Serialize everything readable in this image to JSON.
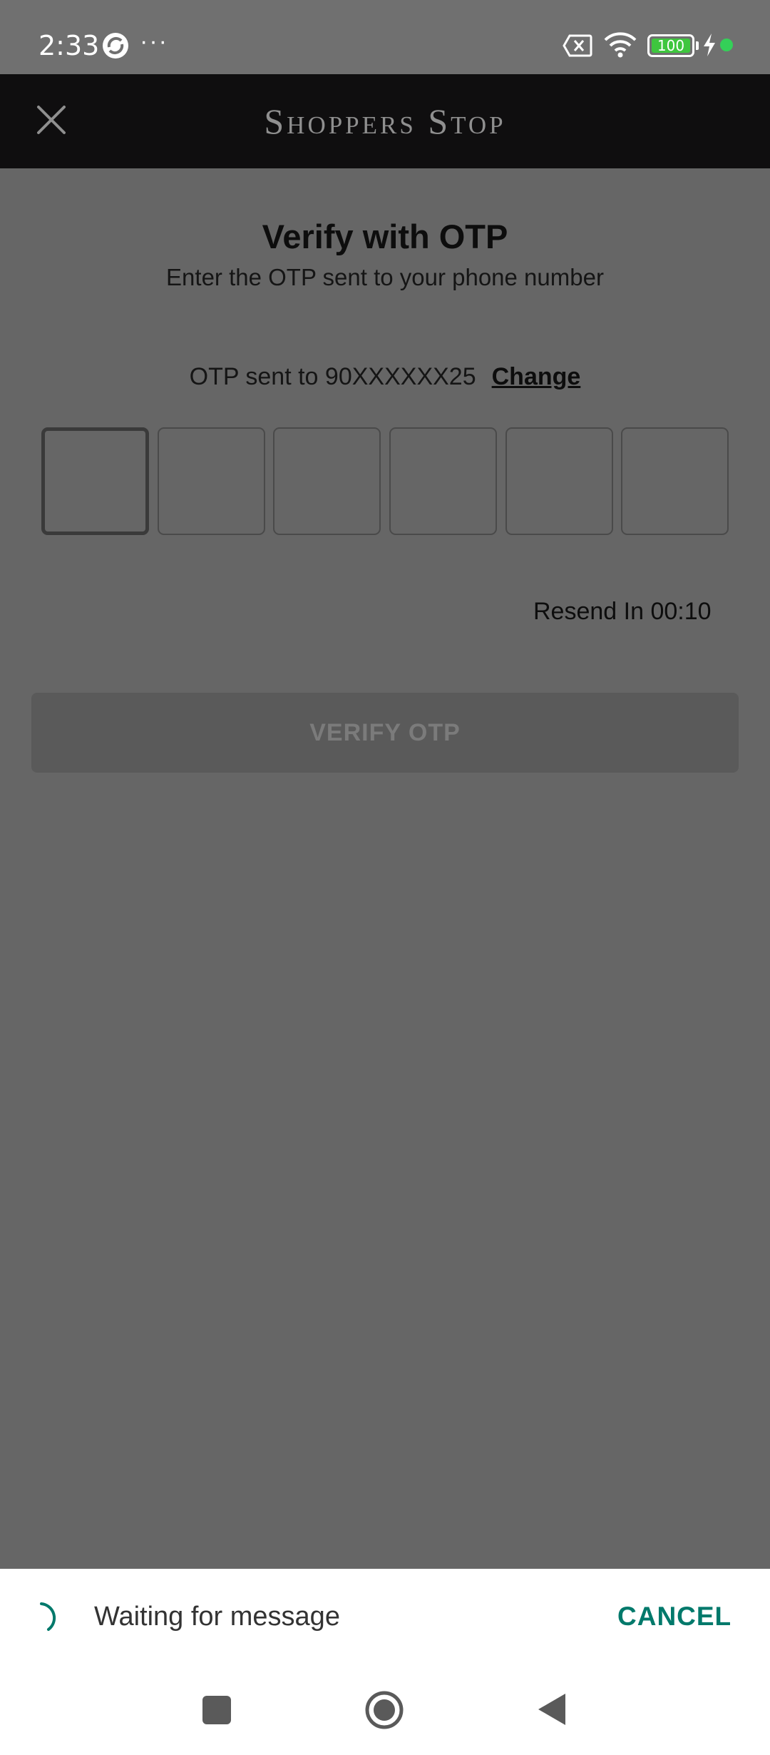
{
  "status_bar": {
    "time": "2:33",
    "more": "···",
    "battery": "100",
    "battery_level": 1.0,
    "icons": [
      "app-sync-icon",
      "sim-none-icon",
      "wifi-icon",
      "battery-icon",
      "charging-icon"
    ],
    "colors": {
      "battery_fill": "#3ec63e",
      "charge_dot": "#34d058"
    }
  },
  "header": {
    "brand": "Shoppers Stop",
    "close_icon": "close-icon"
  },
  "verify": {
    "title": "Verify with OTP",
    "subtitle": "Enter the OTP sent to your phone number",
    "sent_to_label": "OTP sent to 90XXXXXX25",
    "change_label": "Change",
    "otp_digits": [
      "",
      "",
      "",
      "",
      "",
      ""
    ],
    "resend_label": "Resend In 00:10",
    "verify_button_label": "VERIFY OTP"
  },
  "sms_sheet": {
    "waiting_label": "Waiting for message",
    "cancel_label": "CANCEL",
    "accent_color": "#00796b"
  },
  "nav_bar": {
    "icons": [
      "recents-icon",
      "home-icon",
      "back-icon"
    ]
  }
}
